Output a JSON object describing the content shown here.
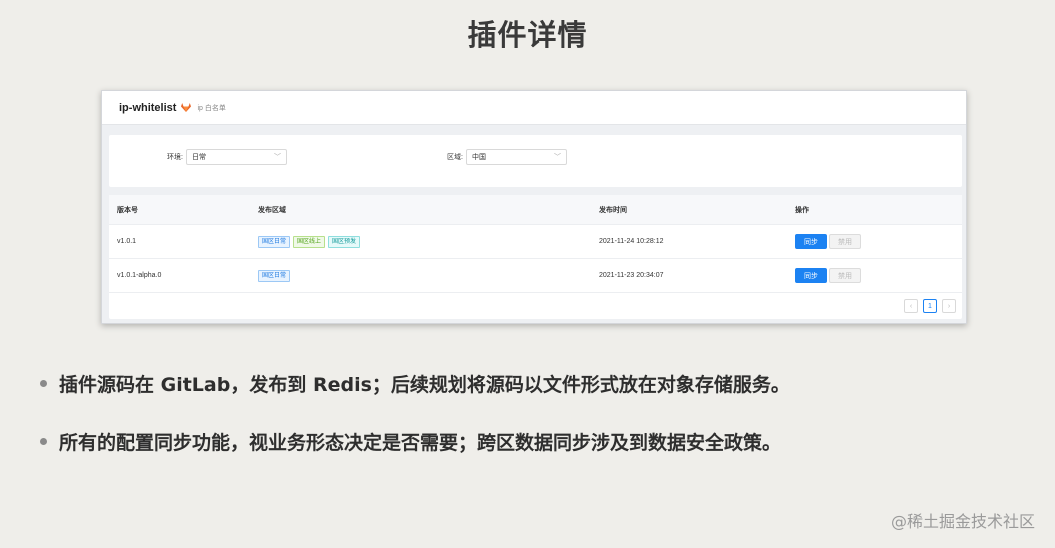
{
  "slide": {
    "title": "插件详情",
    "watermark": "@稀土掘金技术社区",
    "bullets": [
      "插件源码在 GitLab，发布到 Redis；后续规划将源码以文件形式放在对象存储服务。",
      "所有的配置同步功能，视业务形态决定是否需要；跨区数据同步涉及到数据安全政策。"
    ]
  },
  "app": {
    "name": "ip-whitelist",
    "subtitle": "ip 白名单",
    "logo_icon": "gitlab-fox-icon"
  },
  "filters": {
    "env": {
      "label": "环境:",
      "value": "日常"
    },
    "region": {
      "label": "区域:",
      "value": "中国"
    }
  },
  "table": {
    "columns": [
      "版本号",
      "发布区域",
      "发布时间",
      "操作"
    ],
    "rows": [
      {
        "version": "v1.0.1",
        "regions": [
          {
            "text": "国区日常",
            "color": "blue"
          },
          {
            "text": "国区线上",
            "color": "green"
          },
          {
            "text": "国区预发",
            "color": "cyan"
          }
        ],
        "time": "2021-11-24 10:28:12",
        "sync_label": "同步",
        "disable_label": "禁用"
      },
      {
        "version": "v1.0.1-alpha.0",
        "regions": [
          {
            "text": "国区日常",
            "color": "blue"
          }
        ],
        "time": "2021-11-23 20:34:07",
        "sync_label": "同步",
        "disable_label": "禁用"
      }
    ]
  },
  "pagination": {
    "prev": "‹",
    "current": "1",
    "next": "›"
  },
  "colors": {
    "primary": "#1c82f2",
    "background": "#efeeea"
  }
}
